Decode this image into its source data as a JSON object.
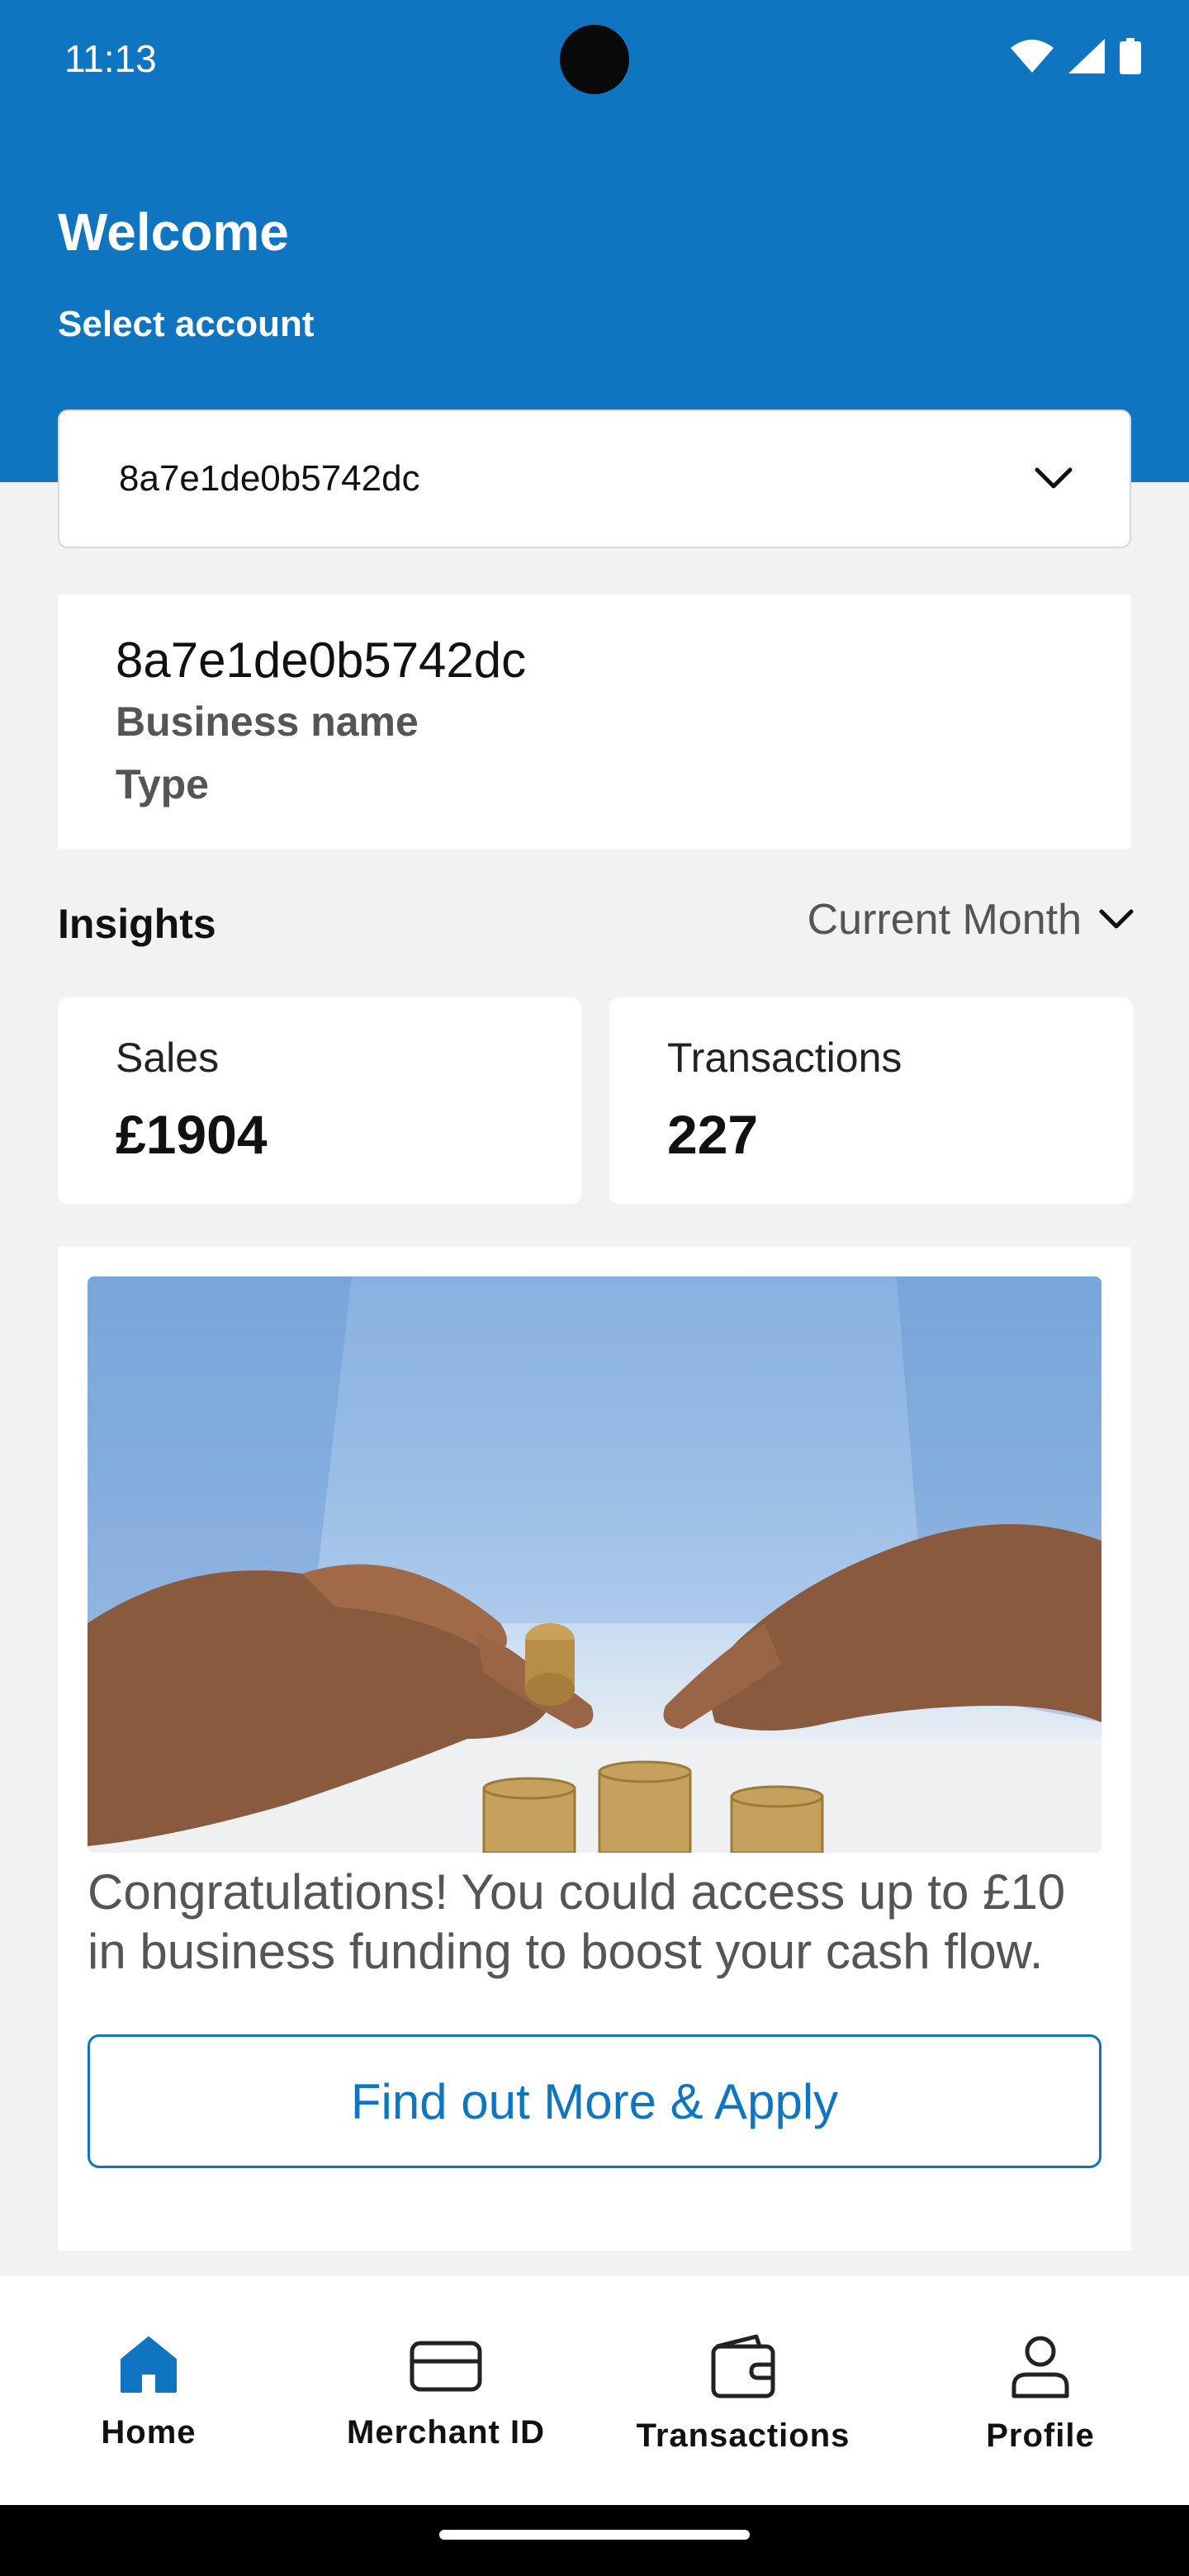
{
  "status_bar": {
    "time": "11:13",
    "icons": [
      "wifi-icon",
      "signal-icon",
      "battery-icon"
    ]
  },
  "header": {
    "title": "Welcome",
    "subtitle": "Select account"
  },
  "account_selector": {
    "value": "8a7e1de0b5742dc",
    "icon": "chevron-down-icon"
  },
  "account_card": {
    "id": "8a7e1de0b5742dc",
    "business_name": "Business name",
    "type": "Type"
  },
  "insights": {
    "title": "Insights",
    "period": "Current Month",
    "sales": {
      "label": "Sales",
      "value": "£1904"
    },
    "transactions": {
      "label": "Transactions",
      "value": "227"
    }
  },
  "promo": {
    "text": "Congratulations! You could access up to £10 in business funding to boost your cash flow.",
    "button_label": "Find out More & Apply"
  },
  "bottom_nav": {
    "items": [
      {
        "label": "Home",
        "icon": "home-icon",
        "active": true
      },
      {
        "label": "Merchant ID",
        "icon": "card-icon",
        "active": false
      },
      {
        "label": "Transactions",
        "icon": "wallet-icon",
        "active": false
      },
      {
        "label": "Profile",
        "icon": "profile-icon",
        "active": false
      }
    ]
  },
  "colors": {
    "brand": "#0f75c1",
    "background": "#f2f2f2",
    "card": "#ffffff"
  }
}
